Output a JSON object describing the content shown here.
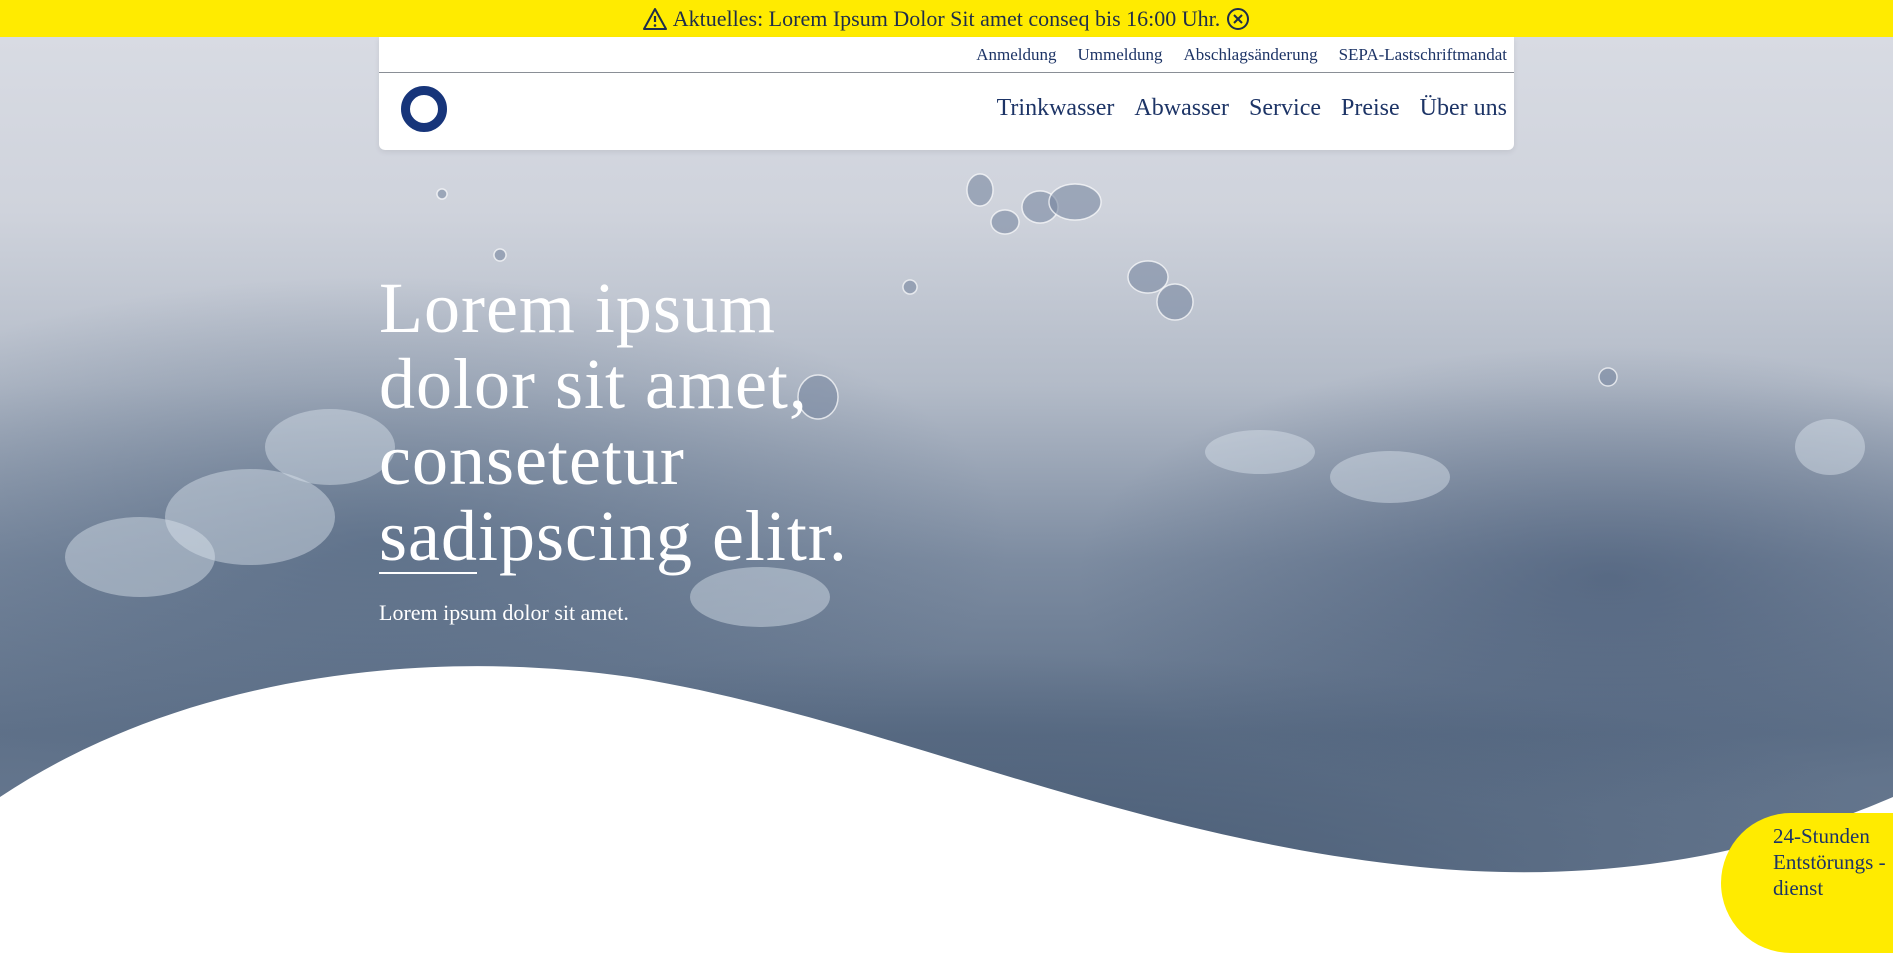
{
  "alert": {
    "icon": "warning-icon",
    "text": "Aktuelles: Lorem Ipsum Dolor Sit amet conseq bis 16:00 Uhr.",
    "close_icon": "close-circle-icon"
  },
  "utility_nav": {
    "items": [
      {
        "label": "Anmeldung"
      },
      {
        "label": "Ummeldung"
      },
      {
        "label": "Abschlagsänderung"
      },
      {
        "label": "SEPA-Lastschriftmandat"
      }
    ]
  },
  "main_nav": {
    "items": [
      {
        "label": "Trinkwasser"
      },
      {
        "label": "Abwasser"
      },
      {
        "label": "Service"
      },
      {
        "label": "Preise"
      },
      {
        "label": "Über uns"
      }
    ]
  },
  "hero": {
    "heading": "Lorem ipsum dolor sit amet, consetetur sadipscing elitr.",
    "subtext": "Lorem ipsum dolor sit amet."
  },
  "emergency": {
    "label": "24-Stunden Entstörungs - dienst"
  },
  "colors": {
    "alert_bg": "#ffeb00",
    "brand_blue": "#17357a",
    "nav_text": "#1d3466",
    "white": "#ffffff"
  }
}
